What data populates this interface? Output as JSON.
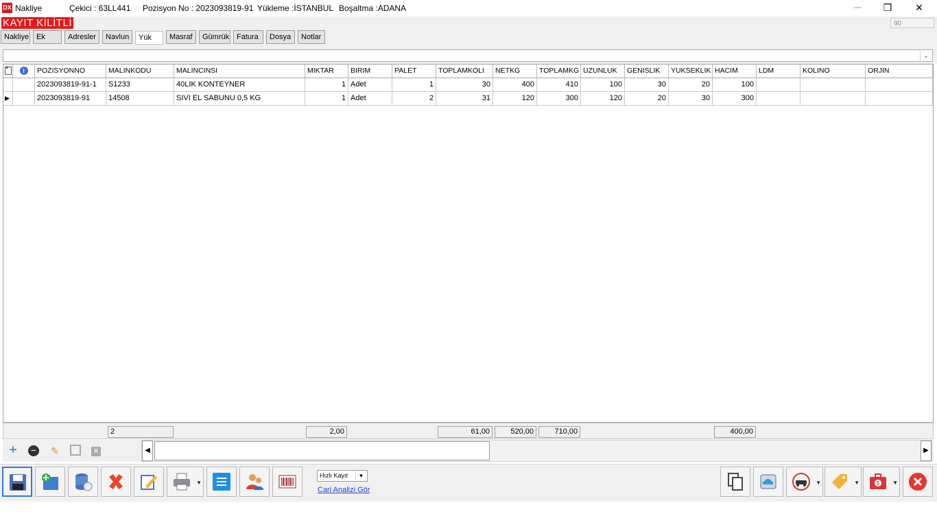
{
  "window": {
    "app_name": "Nakliye",
    "cekici": "Çekici  : 63LL441",
    "pozisyon": "Pozisyon No : 2023093819-91",
    "yukleme": "Yükleme :İSTANBUL",
    "bosaltma": "Boşaltma :ADANA",
    "minimize": "—",
    "restore": "❐",
    "close": "✕"
  },
  "lock": {
    "label": "KAYIT KİLİTLİ",
    "counter": "90"
  },
  "tabs": [
    "Nakliye",
    "Ek",
    "Adresler",
    "Navlun",
    "Yük",
    "Masraf",
    "Gümrük",
    "Fatura",
    "Dosya",
    "Notlar"
  ],
  "active_tab": "Yük",
  "grid": {
    "columns": [
      "POZISYONNO",
      "MALINKODU",
      "MALINCINSI",
      "MIKTAR",
      "BIRIM",
      "PALET",
      "TOPLAMKOLI",
      "NETKG",
      "TOPLAMKG",
      "UZUNLUK",
      "GENISLIK",
      "YUKSEKLIK",
      "HACIM",
      "LDM",
      "KOLINO",
      "ORJIN"
    ],
    "rows": [
      [
        "2023093819-91-1",
        "S1233",
        "40LIK KONTEYNER",
        "1",
        "Adet",
        "1",
        "30",
        "400",
        "410",
        "100",
        "30",
        "20",
        "100",
        "",
        "",
        ""
      ],
      [
        "2023093819-91",
        "14508",
        "SIVI EL SABUNU 0,5 KG",
        "1",
        "Adet",
        "2",
        "31",
        "120",
        "300",
        "120",
        "20",
        "30",
        "300",
        "",
        "",
        ""
      ]
    ],
    "current_row_indicator": "▶"
  },
  "footer": {
    "count": "2",
    "miktar_total": "2,00",
    "toplamkoli_total": "61,00",
    "netkg_total": "520,00",
    "toplamkg_total": "710,00",
    "hacim_total": "400,00"
  },
  "nav_icons": [
    "plus-icon",
    "minus-icon",
    "edit-icon",
    "save-icon",
    "cancel-icon"
  ],
  "toolbar": {
    "hizli_kayit": "Hızlı Kayıt",
    "cari_link": "Cari Analizi Gör"
  },
  "colors": {
    "lock_red": "#e81919",
    "accent_blue": "#3a74d6",
    "link_blue": "#1a3fd6"
  }
}
